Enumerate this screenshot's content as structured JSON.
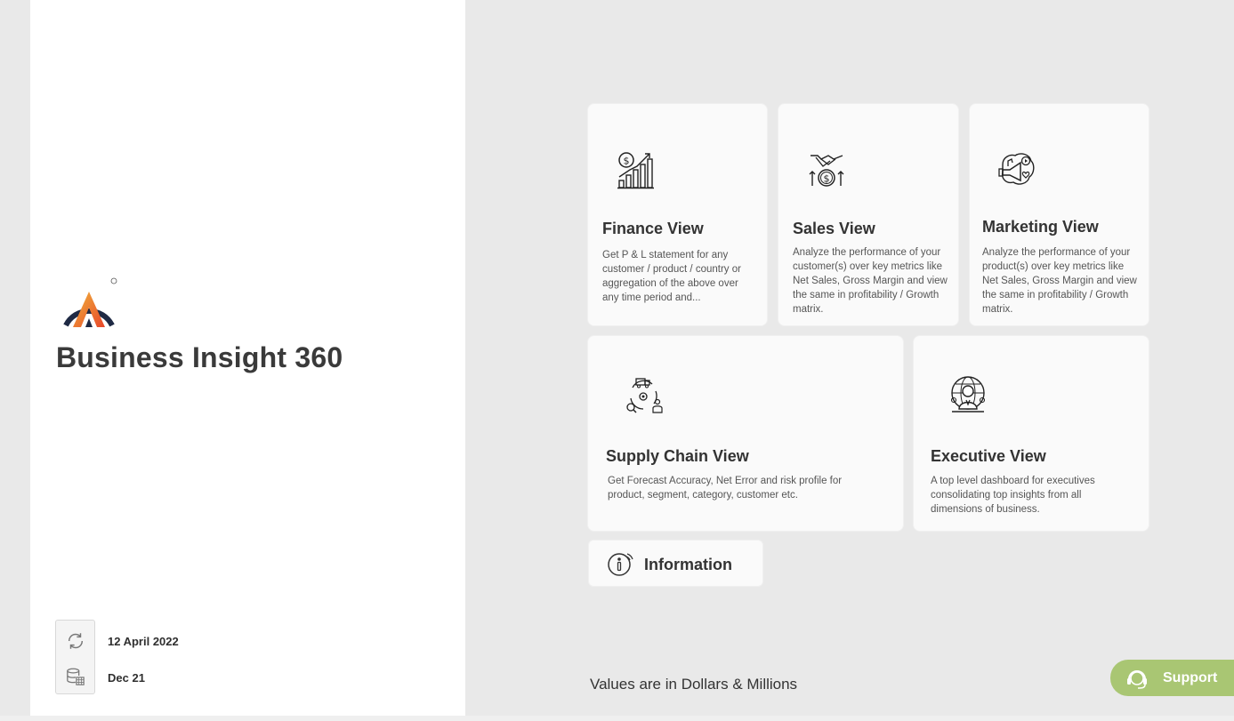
{
  "app": {
    "title": "Business Insight 360",
    "logo_name": "atliq-logo",
    "brand_gradient": [
      "#f0b43c",
      "#e8462a"
    ],
    "brand_dark": "#1f2a44"
  },
  "refresh": {
    "last_refresh": "12 April 2022",
    "data_through": "Dec 21"
  },
  "cards": [
    {
      "id": "finance",
      "title": "Finance View",
      "description": "Get P & L statement for any customer / product / country or aggregation of the above over any time period and...",
      "icon": "finance-chart-icon"
    },
    {
      "id": "sales",
      "title": "Sales View",
      "description": "Analyze the performance of your customer(s) over key metrics like Net Sales, Gross Margin and view the same in profitability / Growth matrix.",
      "icon": "handshake-dollar-icon"
    },
    {
      "id": "marketing",
      "title": "Marketing View",
      "description": "Analyze the performance of your product(s) over key metrics like Net Sales, Gross Margin and view the same in profitability / Growth matrix.",
      "icon": "megaphone-icon"
    },
    {
      "id": "supply-chain",
      "title": "Supply Chain View",
      "description": "Get Forecast Accuracy, Net Error and risk profile for product, segment, category, customer etc.",
      "icon": "supply-chain-cycle-icon"
    },
    {
      "id": "executive",
      "title": "Executive View",
      "description": "A top level dashboard for executives consolidating top insights from all dimensions of business.",
      "icon": "executive-globe-icon"
    }
  ],
  "information": {
    "label": "Information",
    "icon": "info-icon"
  },
  "footnote": "Values are in Dollars & Millions",
  "support": {
    "label": "Support",
    "icon": "headset-icon",
    "color": "#a9c673"
  }
}
